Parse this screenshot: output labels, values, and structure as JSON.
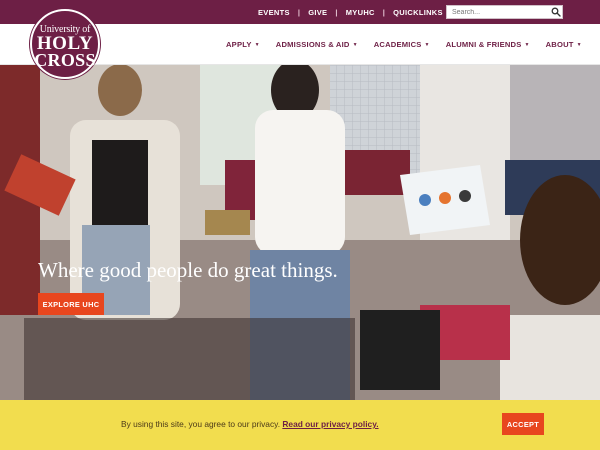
{
  "brand": {
    "logo_line1": "University of",
    "logo_line2": "HOLY",
    "logo_line3": "CROSS",
    "primary_color": "#6d1f45",
    "accent_color": "#e8461e",
    "cookie_bar_color": "#f2dd4e"
  },
  "utility_nav": {
    "links": [
      "EVENTS",
      "GIVE",
      "MYUHC",
      "QUICKLINKS"
    ],
    "separator": "|",
    "search_placeholder": "Search...",
    "search_icon": "magnifier"
  },
  "main_nav": {
    "items": [
      "APPLY",
      "ADMISSIONS & AID",
      "ACADEMICS",
      "ALUMNI & FRIENDS",
      "ABOUT"
    ],
    "dropdown_icon": "caret-down"
  },
  "hero": {
    "headline": "Where good people do great things.",
    "cta_label": "EXPLORE UHC"
  },
  "cookie_notice": {
    "text": "By using this site, you agree to our privacy.",
    "link_text": "Read our privacy policy.",
    "accept_label": "ACCEPT"
  }
}
